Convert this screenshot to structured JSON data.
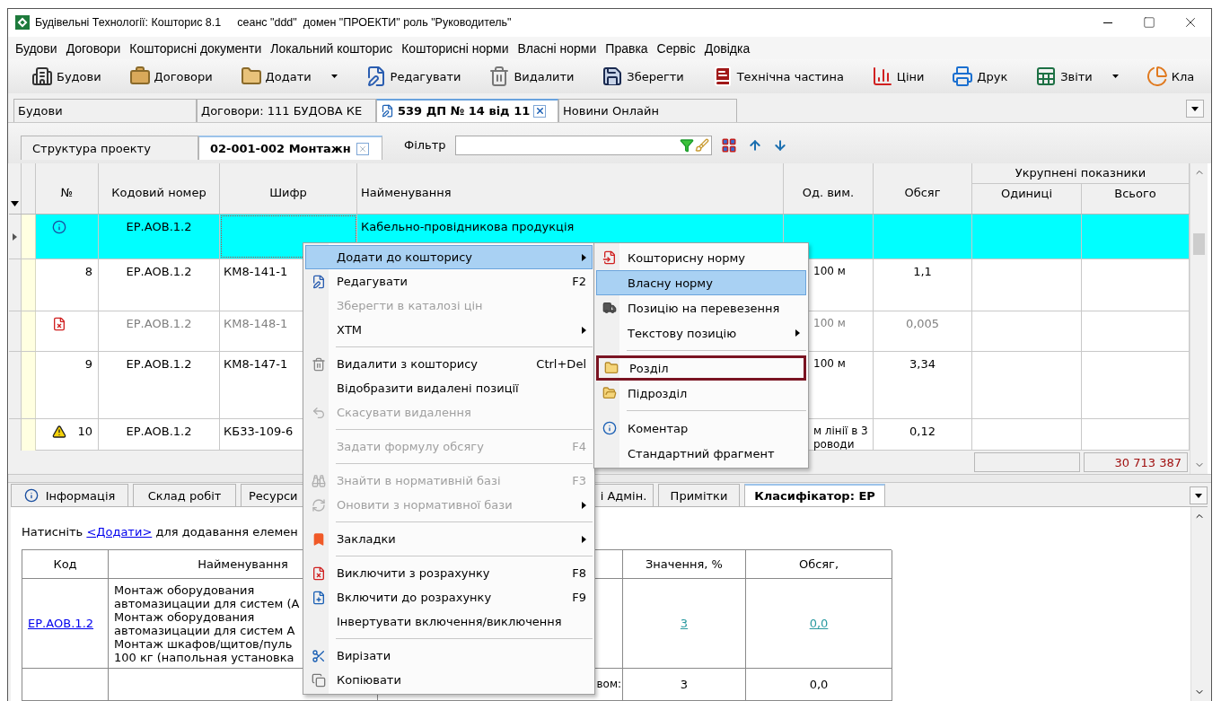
{
  "window": {
    "title": "Будівельні Технології: Кошторис 8.1",
    "session": "сеанс \"ddd\"  домен \"ПРОЕКТИ\" роль \"Руководитель\""
  },
  "menu_bar": [
    "Будови",
    "Договори",
    "Кошторисні документи",
    "Локальний кошторис",
    "Кошторисні норми",
    "Власні норми",
    "Правка",
    "Сервіс",
    "Довідка"
  ],
  "toolbar": [
    {
      "label": "Будови",
      "dropdown": false
    },
    {
      "label": "Договори",
      "dropdown": false
    },
    {
      "label": "Додати",
      "dropdown": true
    },
    {
      "label": "Редагувати",
      "dropdown": false
    },
    {
      "label": "Видалити",
      "dropdown": false
    },
    {
      "label": "Зберегти",
      "dropdown": false
    },
    {
      "label": "Технічна частина",
      "dropdown": false
    },
    {
      "label": "Ціни",
      "dropdown": false
    },
    {
      "label": "Друк",
      "dropdown": false
    },
    {
      "label": "Звіти",
      "dropdown": true
    },
    {
      "label": "Кла",
      "dropdown": false
    }
  ],
  "document_tabs": [
    {
      "label": "Будови",
      "selected": false,
      "closable": false
    },
    {
      "label": "Договори: 111 БУДОВА КЕ",
      "selected": false,
      "closable": false
    },
    {
      "label": "539 ДП № 14 від 11",
      "selected": true,
      "closable": true
    },
    {
      "label": "Новини Онлайн",
      "selected": false,
      "closable": false
    }
  ],
  "project_tabs": [
    {
      "label": "Структура проекту",
      "selected": false,
      "closable": false
    },
    {
      "label": "02-001-002 Монтажн",
      "selected": true,
      "closable": true
    }
  ],
  "filter": {
    "label": "Фільтр"
  },
  "grid": {
    "group_header": "Укрупнені показники",
    "columns": [
      "№",
      "Кодовий номер",
      "Шифр",
      "Найменування",
      "Од. вим.",
      "Обсяг",
      "Одиниці",
      "Всього"
    ],
    "rows": [
      {
        "kind": "info",
        "code": "ЕР.АОВ.1.2",
        "name": "Кабельно-провідникова продукція",
        "selected": true,
        "excluded": false
      },
      {
        "kind": "none",
        "number": "8",
        "code": "ЕР.АОВ.1.2",
        "cipher": "КМ8-141-1",
        "unit": "100 м",
        "volume": "1,1",
        "selected": false,
        "excluded": false
      },
      {
        "kind": "excluded",
        "code": "ЕР.АОВ.1.2",
        "cipher": "КМ8-148-1",
        "unit": "100 м",
        "volume": "0,005",
        "selected": false,
        "excluded": true
      },
      {
        "kind": "none",
        "number": "9",
        "code": "ЕР.АОВ.1.2",
        "cipher": "КМ8-147-1",
        "unit": "100 м",
        "volume": "3,34",
        "selected": false,
        "excluded": false
      },
      {
        "kind": "warning",
        "number": "10",
        "code": "ЕР.АОВ.1.2",
        "cipher": "КБ33-109-6",
        "unit": "м лінії в 3\nроводи",
        "volume": "0,12",
        "selected": false,
        "excluded": false
      }
    ],
    "total": "30 713 387"
  },
  "context_menu": {
    "items": [
      {
        "kind": "item",
        "label": "Додати до кошторису",
        "highlighted": true,
        "disabled": false,
        "submenu": true
      },
      {
        "kind": "item",
        "label": "Редагувати",
        "shortcut": "F2",
        "highlighted": false,
        "disabled": false,
        "submenu": false
      },
      {
        "kind": "item",
        "label": "Зберегти в каталозі цін",
        "highlighted": false,
        "disabled": true,
        "submenu": false
      },
      {
        "kind": "item",
        "label": "ХТМ",
        "highlighted": false,
        "disabled": false,
        "submenu": true
      },
      {
        "kind": "separator"
      },
      {
        "kind": "item",
        "label": "Видалити з кошторису",
        "shortcut": "Ctrl+Del",
        "highlighted": false,
        "disabled": false,
        "submenu": false
      },
      {
        "kind": "item",
        "label": "Відобразити видалені позиції",
        "highlighted": false,
        "disabled": false,
        "submenu": false
      },
      {
        "kind": "item",
        "label": "Скасувати видалення",
        "highlighted": false,
        "disabled": true,
        "submenu": false
      },
      {
        "kind": "separator"
      },
      {
        "kind": "item",
        "label": "Задати формулу обсягу",
        "shortcut": "F4",
        "highlighted": false,
        "disabled": true,
        "submenu": false
      },
      {
        "kind": "separator"
      },
      {
        "kind": "item",
        "label": "Знайти в нормативній базі",
        "shortcut": "F3",
        "highlighted": false,
        "disabled": true,
        "submenu": false
      },
      {
        "kind": "item",
        "label": "Оновити з нормативної бази",
        "highlighted": false,
        "disabled": true,
        "submenu": true
      },
      {
        "kind": "separator"
      },
      {
        "kind": "item",
        "label": "Закладки",
        "highlighted": false,
        "disabled": false,
        "submenu": true
      },
      {
        "kind": "separator"
      },
      {
        "kind": "item",
        "label": "Виключити з розрахунку",
        "shortcut": "F8",
        "highlighted": false,
        "disabled": false,
        "submenu": false
      },
      {
        "kind": "item",
        "label": "Включити до розрахунку",
        "shortcut": "F9",
        "highlighted": false,
        "disabled": false,
        "submenu": false
      },
      {
        "kind": "item",
        "label": "Інвертувати включення/виключення",
        "highlighted": false,
        "disabled": false,
        "submenu": false
      },
      {
        "kind": "separator"
      },
      {
        "kind": "item",
        "label": "Вирізати",
        "highlighted": false,
        "disabled": false,
        "submenu": false
      },
      {
        "kind": "item",
        "label": "Копіювати",
        "highlighted": false,
        "disabled": false,
        "submenu": false
      }
    ]
  },
  "submenu": {
    "items": [
      {
        "kind": "item",
        "label": "Кошторисну норму",
        "selected": false,
        "outlined": false,
        "submenu": false
      },
      {
        "kind": "item",
        "label": "Власну норму",
        "selected": true,
        "outlined": false,
        "submenu": false
      },
      {
        "kind": "item",
        "label": "Позицію на перевезення",
        "selected": false,
        "outlined": false,
        "submenu": false
      },
      {
        "kind": "item",
        "label": "Текстову позицію",
        "selected": false,
        "outlined": false,
        "submenu": true
      },
      {
        "kind": "separator"
      },
      {
        "kind": "item",
        "label": "Розділ",
        "selected": false,
        "outlined": true,
        "submenu": false
      },
      {
        "kind": "item",
        "label": "Підрозділ",
        "selected": false,
        "outlined": false,
        "submenu": false
      },
      {
        "kind": "separator"
      },
      {
        "kind": "item",
        "label": "Коментар",
        "selected": false,
        "outlined": false,
        "submenu": false
      },
      {
        "kind": "item",
        "label": "Стандартний фрагмент",
        "selected": false,
        "outlined": false,
        "submenu": false
      }
    ]
  },
  "bottom_tabs": [
    {
      "label": "Інформація",
      "selected": false
    },
    {
      "label": "Склад робіт",
      "selected": false
    },
    {
      "label": "Ресурси",
      "selected": false
    },
    {
      "label": "і Адмін.",
      "selected": false
    },
    {
      "label": "Примітки",
      "selected": false
    },
    {
      "label": "Класифікатор: ЕР",
      "selected": true
    }
  ],
  "classifier": {
    "hint": "Натисніть",
    "link": "<Додати>",
    "hint_end": "для додавання елемен",
    "columns": [
      "Код",
      "Найменування",
      "Значення, %",
      "Обсяг,"
    ],
    "rows": [
      {
        "kind": "item",
        "code": "ЕР.АОВ.1.2",
        "name": " Монтаж оборудования\nавтомазицации для систем (А\nМонтаж оборудования\nавтомазицации для систем А\nМонтаж шкафов/щитов/пуль\n100 кг (напольная установка",
        "value": "3",
        "volume": "0,0"
      },
      {
        "kind": "total",
        "label": "вом:",
        "value": "3",
        "volume": "0,0"
      }
    ]
  }
}
